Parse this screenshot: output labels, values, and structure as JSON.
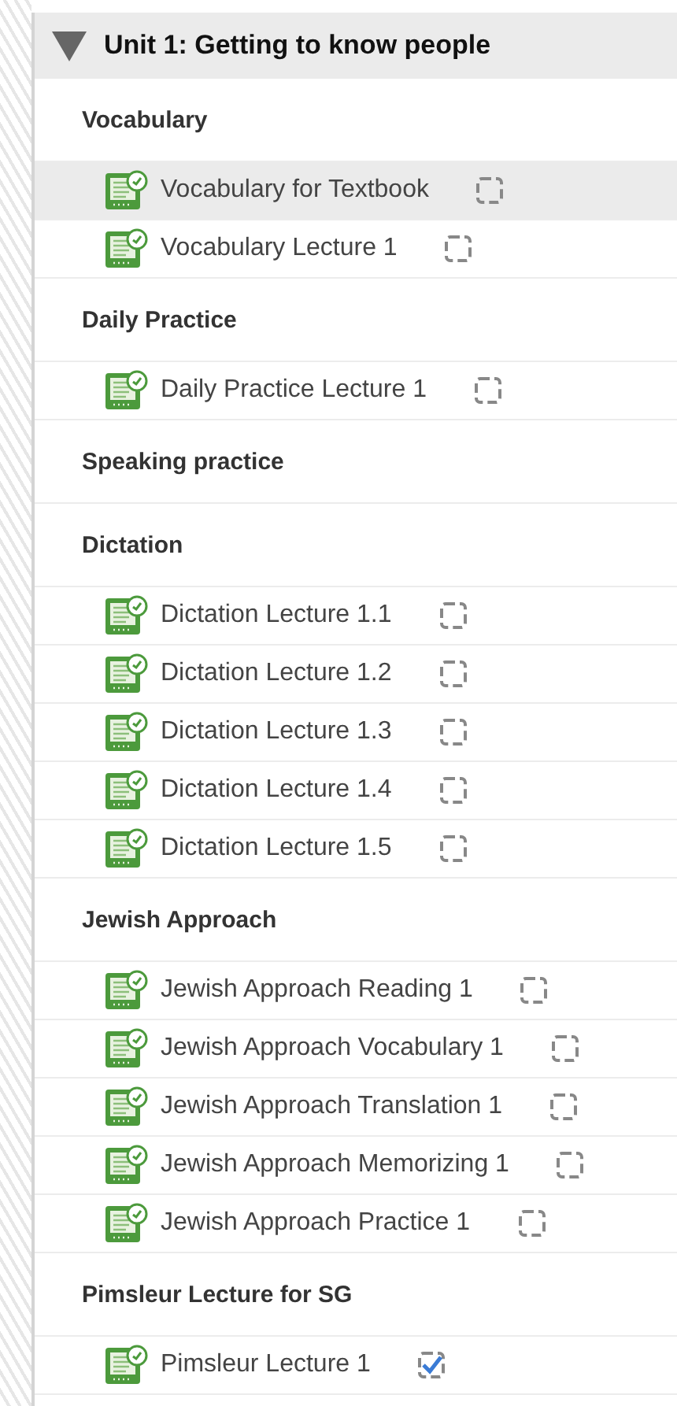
{
  "unit": {
    "title": "Unit 1: Getting to know people",
    "expanded": true
  },
  "sections": [
    {
      "heading": "Vocabulary",
      "items": [
        {
          "label": "Vocabulary for Textbook",
          "highlighted": true,
          "checked": false
        },
        {
          "label": "Vocabulary Lecture 1",
          "highlighted": false,
          "checked": false
        }
      ]
    },
    {
      "heading": "Daily Practice",
      "items": [
        {
          "label": "Daily Practice Lecture 1",
          "highlighted": false,
          "checked": false
        }
      ]
    },
    {
      "heading": "Speaking practice"
    },
    {
      "heading": "Dictation",
      "items": [
        {
          "label": "Dictation Lecture 1.1",
          "highlighted": false,
          "checked": false
        },
        {
          "label": "Dictation Lecture 1.2",
          "highlighted": false,
          "checked": false
        },
        {
          "label": "Dictation Lecture 1.3",
          "highlighted": false,
          "checked": false
        },
        {
          "label": "Dictation Lecture 1.4",
          "highlighted": false,
          "checked": false
        },
        {
          "label": "Dictation Lecture 1.5",
          "highlighted": false,
          "checked": false
        }
      ]
    },
    {
      "heading": "Jewish Approach",
      "items": [
        {
          "label": "Jewish Approach Reading 1",
          "highlighted": false,
          "checked": false
        },
        {
          "label": "Jewish Approach Vocabulary 1",
          "highlighted": false,
          "checked": false
        },
        {
          "label": "Jewish Approach Translation 1",
          "highlighted": false,
          "checked": false
        },
        {
          "label": "Jewish Approach Memorizing 1",
          "highlighted": false,
          "checked": false
        },
        {
          "label": "Jewish Approach Practice 1",
          "highlighted": false,
          "checked": false
        }
      ]
    },
    {
      "heading": "Pimsleur Lecture for SG",
      "items": [
        {
          "label": "Pimsleur Lecture 1",
          "highlighted": false,
          "checked": true
        }
      ]
    }
  ]
}
